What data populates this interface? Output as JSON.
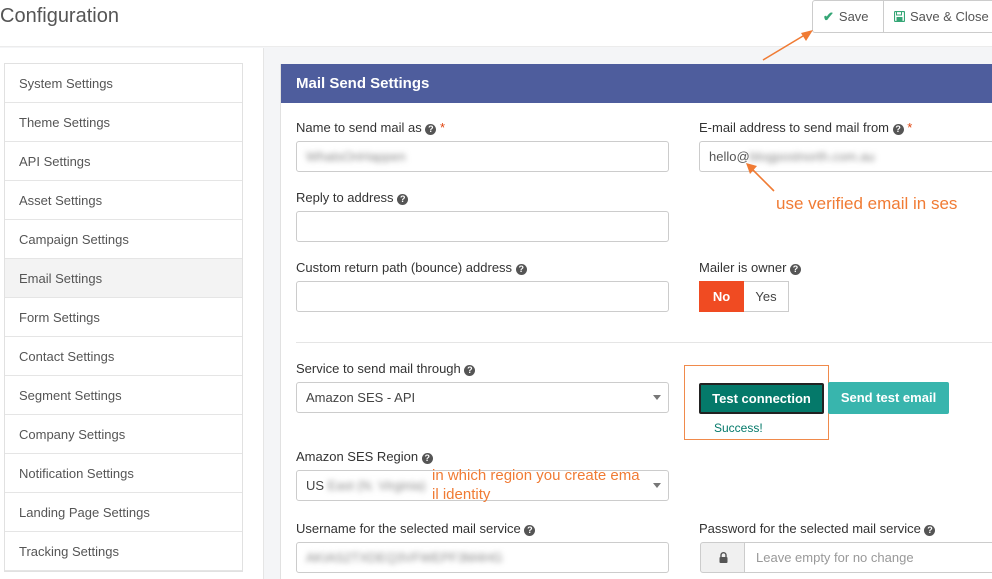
{
  "page": {
    "title": "Configuration"
  },
  "toolbar": {
    "save_label": "Save",
    "save_close_label": "Save & Close"
  },
  "sidebar": {
    "items": [
      {
        "label": "System Settings"
      },
      {
        "label": "Theme Settings"
      },
      {
        "label": "API Settings"
      },
      {
        "label": "Asset Settings"
      },
      {
        "label": "Campaign Settings"
      },
      {
        "label": "Email Settings",
        "active": true
      },
      {
        "label": "Form Settings"
      },
      {
        "label": "Contact Settings"
      },
      {
        "label": "Segment Settings"
      },
      {
        "label": "Company Settings"
      },
      {
        "label": "Notification Settings"
      },
      {
        "label": "Landing Page Settings"
      },
      {
        "label": "Tracking Settings"
      }
    ]
  },
  "panel": {
    "title": "Mail Send Settings",
    "fields": {
      "from_name": {
        "label": "Name to send mail as",
        "value": "WhatsOnHappen"
      },
      "from_email": {
        "label": "E-mail address to send mail from",
        "value_visible": "hello@",
        "value_blurred": "blogpostnorth.com.au"
      },
      "reply_to": {
        "label": "Reply to address",
        "value": ""
      },
      "return_path": {
        "label": "Custom return path (bounce) address",
        "value": ""
      },
      "mailer_owner": {
        "label": "Mailer is owner",
        "options": [
          "No",
          "Yes"
        ],
        "selected": "No"
      },
      "service": {
        "label": "Service to send mail through",
        "value": "Amazon SES - API"
      },
      "region": {
        "label": "Amazon SES Region",
        "value_visible": "US ",
        "value_blurred": "East (N. Virginia)"
      },
      "username": {
        "label": "Username for the selected mail service",
        "value": "AKIAS2TXDEQ3VFWEPF3M4HG"
      },
      "password": {
        "label": "Password for the selected mail service",
        "placeholder": "Leave empty for no change"
      }
    },
    "buttons": {
      "test_connection": "Test connection",
      "send_test_email": "Send test email"
    },
    "status": {
      "connection": "Success!"
    }
  },
  "annotations": {
    "verified_email": "use verified email in ses",
    "region_line1": "in which region you create ema",
    "region_line2": "il identity"
  },
  "colors": {
    "panel_header": "#4e5d9d",
    "toggle_active": "#f04b22",
    "test_button": "#04796a",
    "send_button": "#38b5ad",
    "annotation": "#f07b34",
    "required": "#e0440e"
  }
}
